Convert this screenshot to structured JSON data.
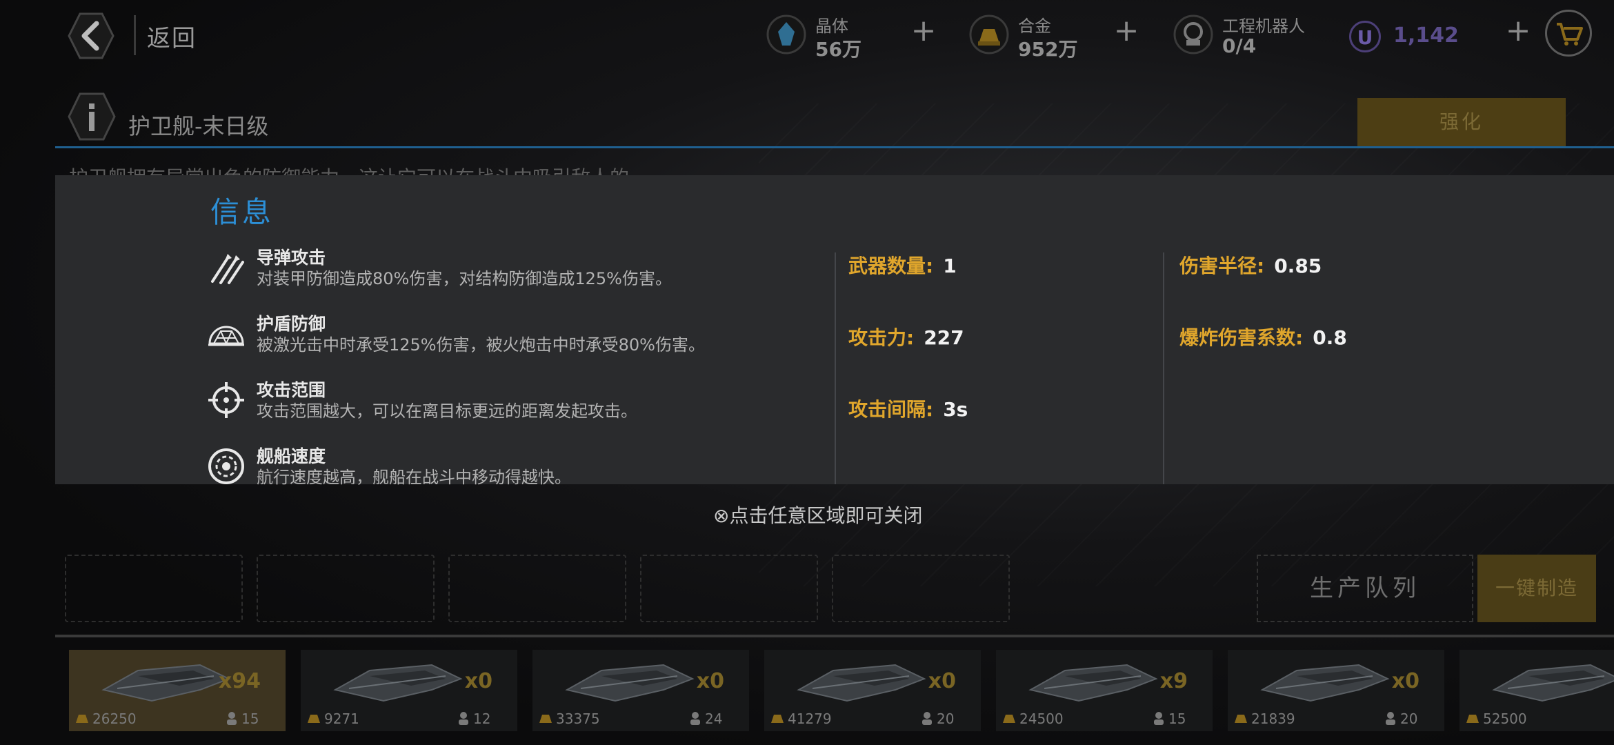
{
  "header": {
    "back_label": "返回",
    "resources": [
      {
        "name": "晶体",
        "value": "56万",
        "icon": "crystal-icon"
      },
      {
        "name": "合金",
        "value": "952万",
        "icon": "alloy-icon"
      },
      {
        "name": "工程机器人",
        "value": "0/4",
        "icon": "robot-icon"
      }
    ],
    "premium": {
      "badge": "U",
      "value": "1,142"
    }
  },
  "ship": {
    "title": "护卫舰-末日级",
    "strengthen_label": "强化",
    "description_peek": "护卫舰拥有异常出色的防御能力，这让它可以在战斗中吸引敌人的"
  },
  "popup": {
    "title": "信息",
    "features": [
      {
        "name": "导弹攻击",
        "desc": "对装甲防御造成80%伤害，对结构防御造成125%伤害。",
        "icon": "missile-icon"
      },
      {
        "name": "护盾防御",
        "desc": "被激光击中时承受125%伤害，被火炮击中时承受80%伤害。",
        "icon": "shield-dome-icon"
      },
      {
        "name": "攻击范围",
        "desc": "攻击范围越大，可以在离目标更远的距离发起攻击。",
        "icon": "crosshair-icon"
      },
      {
        "name": "舰船速度",
        "desc": "航行速度越高，舰船在战斗中移动得越快。",
        "icon": "speed-icon"
      }
    ],
    "stats_col1": [
      {
        "label": "武器数量:",
        "value": "1"
      },
      {
        "label": "攻击力:",
        "value": "227"
      },
      {
        "label": "攻击间隔:",
        "value": "3s"
      }
    ],
    "stats_col2": [
      {
        "label": "伤害半径:",
        "value": "0.85"
      },
      {
        "label": "爆炸伤害系数:",
        "value": "0.8"
      }
    ],
    "close_hint": "⊗点击任意区域即可关闭"
  },
  "production": {
    "queue_label": "生产队列",
    "make_label": "一键制造"
  },
  "ships": [
    {
      "count": "x94",
      "cost": "26250",
      "crew": "15",
      "selected": true
    },
    {
      "count": "x0",
      "cost": "9271",
      "crew": "12"
    },
    {
      "count": "x0",
      "cost": "33375",
      "crew": "24"
    },
    {
      "count": "x0",
      "cost": "41279",
      "crew": "20"
    },
    {
      "count": "x9",
      "cost": "24500",
      "crew": "15"
    },
    {
      "count": "x0",
      "cost": "21839",
      "crew": "20"
    },
    {
      "count": "",
      "cost": "52500",
      "crew": ""
    }
  ],
  "colors": {
    "accent_blue": "#2c8fd6",
    "stat_label": "#e0a62c",
    "gold_button": "#4d3e14"
  }
}
